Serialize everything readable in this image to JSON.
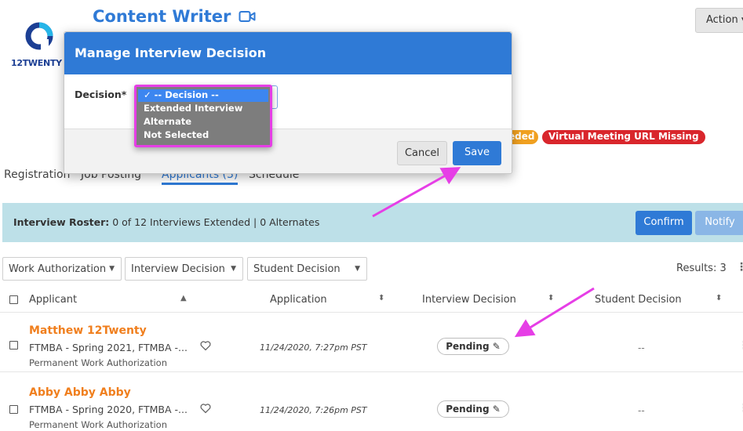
{
  "header": {
    "logo_text": "12TWENTY",
    "title": "Content Writer",
    "action_label": "Action",
    "action_caret": "▾",
    "badge_orange_text": "eded",
    "badge_red_text": "Virtual Meeting URL Missing"
  },
  "tabs": [
    {
      "label": "Registration"
    },
    {
      "label": "Job Posting"
    },
    {
      "label": "Applicants (3)"
    },
    {
      "label": "Schedule"
    }
  ],
  "roster": {
    "label": "Interview Roster:",
    "text": "0 of 12 Interviews Extended | 0 Alternates",
    "confirm_label": "Confirm",
    "notify_label": "Notify"
  },
  "filters": {
    "work_authorization": "Work Authorization",
    "interview_decision": "Interview Decision",
    "student_decision": "Student Decision",
    "caret": "▼",
    "results": "Results: 3"
  },
  "table": {
    "headers": {
      "applicant": "Applicant",
      "application": "Application",
      "interview_decision": "Interview Decision",
      "student_decision": "Student Decision"
    },
    "rows": [
      {
        "name": "Matthew 12Twenty",
        "program": "FTMBA - Spring 2021, FTMBA -...",
        "authorization": "Permanent Work Authorization",
        "date": "11/24/2020, 7:27pm PST",
        "decision": "Pending",
        "student_decision": "--"
      },
      {
        "name": "Abby Abby Abby",
        "program": "FTMBA - Spring 2020, FTMBA -...",
        "authorization": "Permanent Work Authorization",
        "date": "11/24/2020, 7:26pm PST",
        "decision": "Pending",
        "student_decision": "--"
      }
    ]
  },
  "modal": {
    "title": "Manage Interview Decision",
    "decision_label": "Decision*",
    "options": [
      {
        "label": "✓ -- Decision --",
        "selected": true
      },
      {
        "label": "Extended Interview",
        "selected": false
      },
      {
        "label": "Alternate",
        "selected": false
      },
      {
        "label": "Not Selected",
        "selected": false
      }
    ],
    "cancel_label": "Cancel",
    "save_label": "Save"
  },
  "colors": {
    "brand_blue": "#2f7ad6",
    "applicant_orange": "#f07f1e",
    "annotation_magenta": "#e63ee6",
    "badge_red": "#d9262c",
    "badge_orange": "#f0a020",
    "roster_bg": "#bde0e8"
  }
}
